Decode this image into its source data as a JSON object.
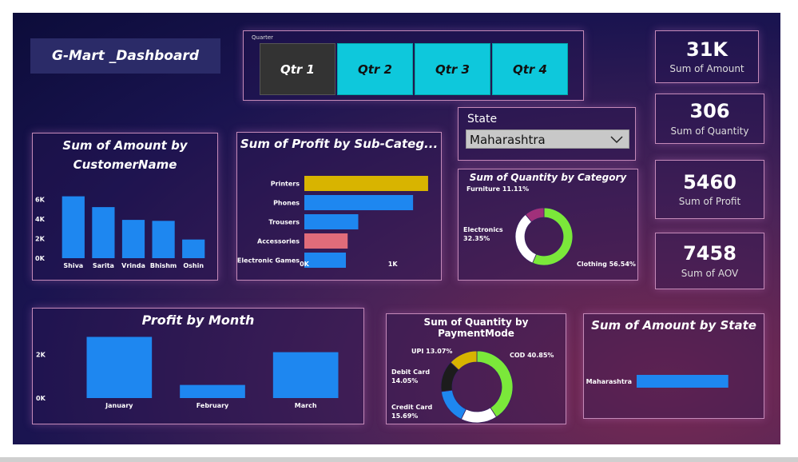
{
  "dashboard_title": "G-Mart _Dashboard",
  "quarter_slicer": {
    "label": "Quarter",
    "options": [
      "Qtr 1",
      "Qtr 2",
      "Qtr 3",
      "Qtr 4"
    ],
    "selected": "Qtr 1"
  },
  "state_slicer": {
    "label": "State",
    "selected": "Maharashtra"
  },
  "kpis": [
    {
      "value": "31K",
      "label": "Sum of Amount"
    },
    {
      "value": "306",
      "label": "Sum of Quantity"
    },
    {
      "value": "5460",
      "label": "Sum of Profit"
    },
    {
      "value": "7458",
      "label": "Sum of AOV"
    }
  ],
  "colors": {
    "bar_blue": "#1e87f0",
    "gold": "#d8b400",
    "pink": "#e06c7a",
    "green": "#7be83a",
    "magenta": "#a0307a",
    "white": "#ffffff",
    "cyan": "#0ec8dc",
    "dark": "#1c1c1c"
  },
  "chart_data": [
    {
      "id": "amount_by_customer",
      "type": "bar",
      "title": "Sum of Amount by CustomerName",
      "categories": [
        "Shiva",
        "Sarita",
        "Vrinda",
        "Bhishm",
        "Oshin"
      ],
      "values": [
        6300,
        5200,
        3900,
        3800,
        1900
      ],
      "ylim": [
        0,
        7000
      ],
      "yticks": [
        "0K",
        "2K",
        "4K",
        "6K"
      ],
      "ytick_values": [
        0,
        2000,
        4000,
        6000
      ]
    },
    {
      "id": "profit_by_subcategory",
      "type": "bar",
      "orientation": "horizontal",
      "title": "Sum of Profit by Sub-Categ...",
      "categories": [
        "Printers",
        "Phones",
        "Trousers",
        "Accessories",
        "Electronic Games"
      ],
      "values": [
        1400,
        1230,
        610,
        490,
        470
      ],
      "xlim": [
        0,
        1500
      ],
      "xticks": [
        "0K",
        "1K"
      ],
      "xtick_values": [
        0,
        1000
      ]
    },
    {
      "id": "quantity_by_category",
      "type": "pie",
      "title": "Sum of Quantity by Category",
      "labels": [
        "Clothing 56.54%",
        "Electronics 32.35%",
        "Furniture 11.11%"
      ],
      "values": [
        56.54,
        32.35,
        11.11
      ]
    },
    {
      "id": "profit_by_month",
      "type": "bar",
      "title": "Profit by Month",
      "categories": [
        "January",
        "February",
        "March"
      ],
      "values": [
        2800,
        600,
        2100
      ],
      "ylim": [
        0,
        3000
      ],
      "yticks": [
        "0K",
        "2K"
      ],
      "ytick_values": [
        0,
        2000
      ]
    },
    {
      "id": "quantity_by_paymentmode",
      "type": "pie",
      "title": "Sum of Quantity by PaymentMode",
      "labels": [
        "COD 40.85%",
        "EMI 16.34%",
        "Credit Card 15.69%",
        "Debit Card 14.05%",
        "UPI 13.07%"
      ],
      "values": [
        40.85,
        16.34,
        15.69,
        14.05,
        13.07
      ]
    },
    {
      "id": "amount_by_state",
      "type": "bar",
      "orientation": "horizontal",
      "title": "Sum of Amount by State",
      "categories": [
        "Maharashtra"
      ],
      "values": [
        31000
      ],
      "xlim": [
        0,
        40000
      ],
      "xticks": [
        "0K",
        "20K",
        "40K"
      ],
      "xtick_values": [
        0,
        20000,
        40000
      ]
    }
  ]
}
